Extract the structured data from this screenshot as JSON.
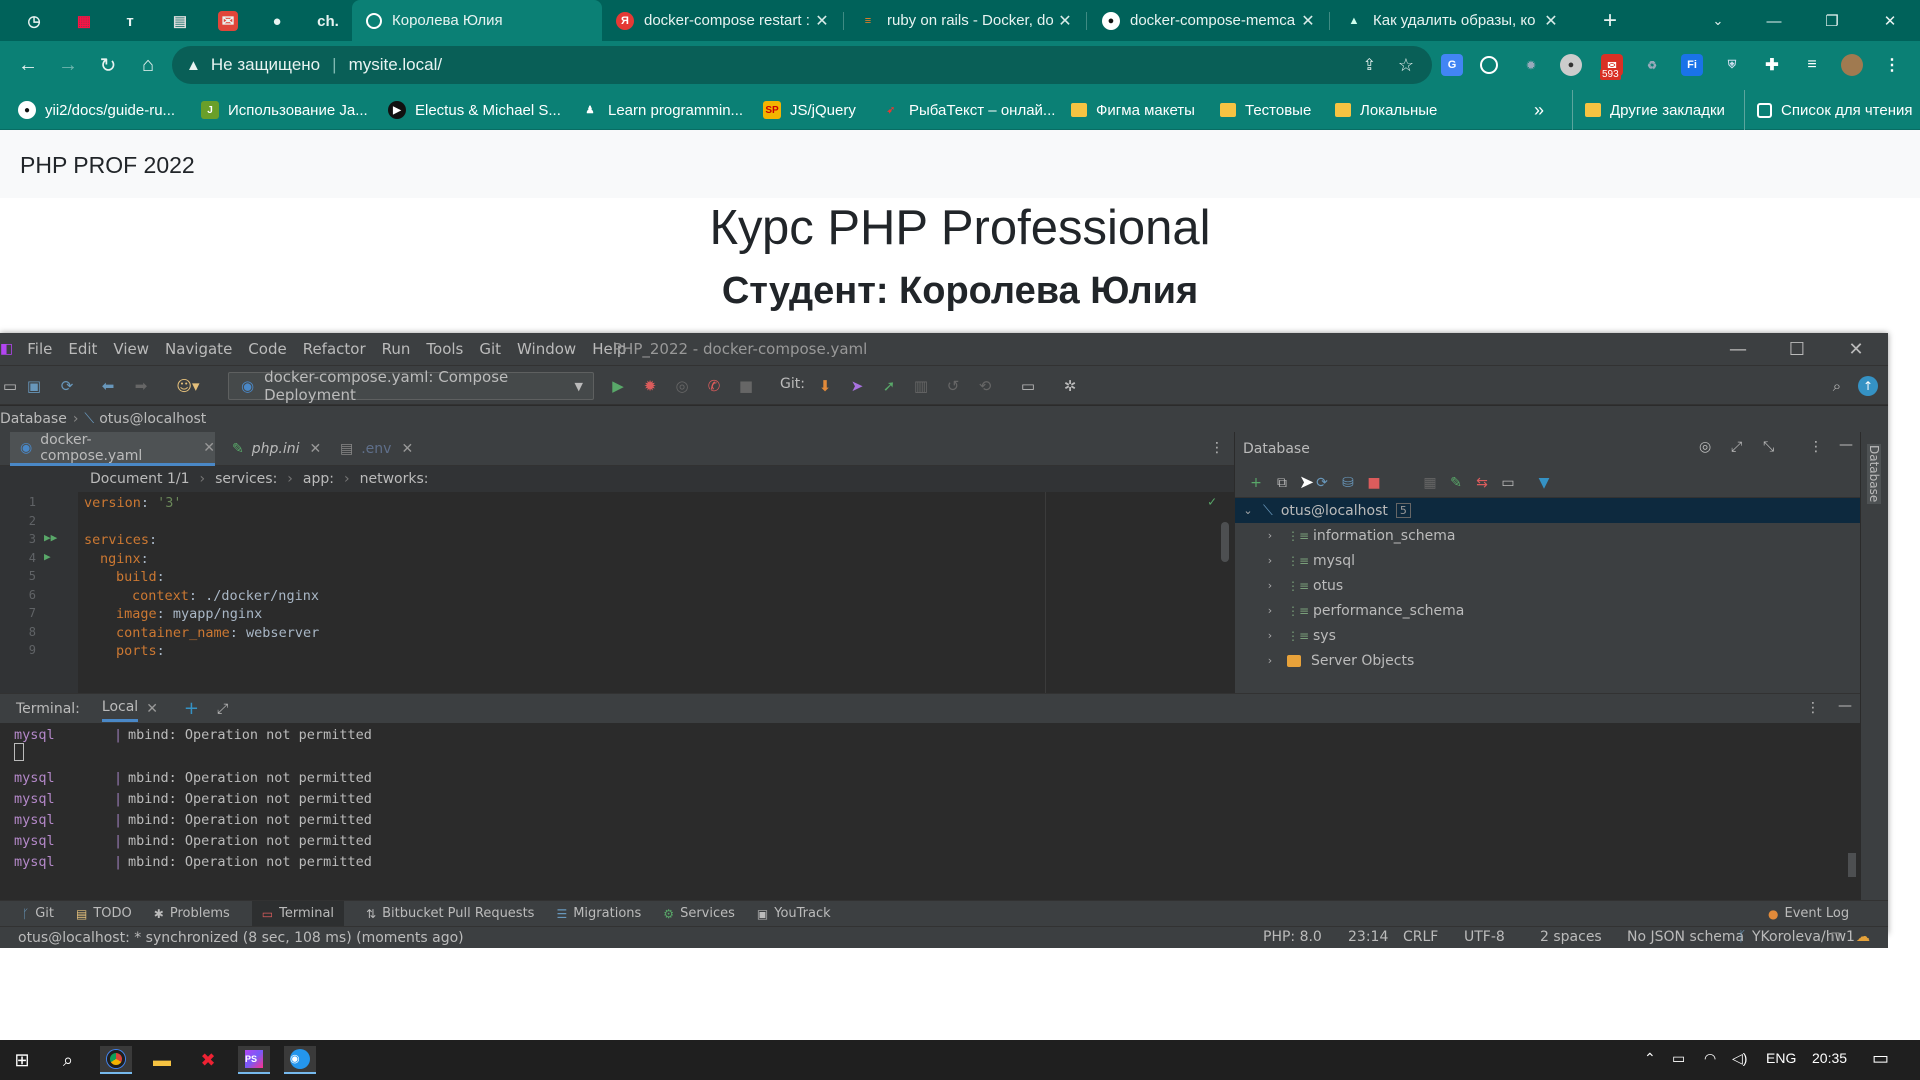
{
  "browser": {
    "pinned_tabs": [
      "ch."
    ],
    "tabs": [
      {
        "title": "Королева Юлия",
        "icon": "globe"
      },
      {
        "title": "docker-compose restart :",
        "icon": "yandex"
      },
      {
        "title": "ruby on rails - Docker, do",
        "icon": "stackoverflow"
      },
      {
        "title": "docker-compose-memca",
        "icon": "github"
      },
      {
        "title": "Как удалить образы, ко",
        "icon": "cap"
      }
    ],
    "new_tab": "+",
    "address": {
      "security": "Не защищено",
      "url": "mysite.local/"
    },
    "extension_badge": "593",
    "bookmarks": [
      "yii2/docs/guide-ru...",
      "Использование Ja...",
      "Electus & Michael S...",
      "Learn programmin...",
      "JS/jQuery",
      "РыбаТекст – онлай...",
      "Фигма макеты",
      "Тестовые",
      "Локальные"
    ],
    "bookmarks_more": "»",
    "other_bookmarks": "Другие закладки",
    "reading_list": "Список для чтения"
  },
  "page": {
    "brand": "PHP PROF 2022",
    "heading": "Курс PHP Professional",
    "subheading": "Студент: Королева Юлия"
  },
  "ide": {
    "menu": [
      "File",
      "Edit",
      "View",
      "Navigate",
      "Code",
      "Refactor",
      "Run",
      "Tools",
      "Git",
      "Window",
      "Help"
    ],
    "title": "PHP_2022 - docker-compose.yaml",
    "run_config": "docker-compose.yaml: Compose Deployment",
    "git_label": "Git:",
    "breadcrumb": [
      "Database",
      "otus@localhost"
    ],
    "editor_tabs": [
      "docker-compose.yaml",
      "php.ini",
      ".env"
    ],
    "editor_crumbs": [
      "Document 1/1",
      "services:",
      "app:",
      "networks:"
    ],
    "code": [
      {
        "n": "1",
        "parts": [
          [
            "k",
            "version"
          ],
          [
            "v",
            ": "
          ],
          [
            "s",
            "'3'"
          ]
        ],
        "indent": 0
      },
      {
        "n": "2",
        "parts": [],
        "indent": 0
      },
      {
        "n": "3",
        "parts": [
          [
            "k",
            "services"
          ],
          [
            "v",
            ":"
          ]
        ],
        "indent": 0
      },
      {
        "n": "4",
        "parts": [
          [
            "k",
            "nginx"
          ],
          [
            "v",
            ":"
          ]
        ],
        "indent": 1
      },
      {
        "n": "5",
        "parts": [
          [
            "k",
            "build"
          ],
          [
            "v",
            ":"
          ]
        ],
        "indent": 2
      },
      {
        "n": "6",
        "parts": [
          [
            "k",
            "context"
          ],
          [
            "v",
            ": ./docker/nginx"
          ]
        ],
        "indent": 3
      },
      {
        "n": "7",
        "parts": [
          [
            "k",
            "image"
          ],
          [
            "v",
            ": "
          ],
          [
            "v",
            "myapp/nginx"
          ]
        ],
        "indent": 2
      },
      {
        "n": "8",
        "parts": [
          [
            "k",
            "container_name"
          ],
          [
            "v",
            ": webserver"
          ]
        ],
        "indent": 2
      },
      {
        "n": "9",
        "parts": [
          [
            "k",
            "ports"
          ],
          [
            "v",
            ":"
          ]
        ],
        "indent": 2
      }
    ],
    "database": {
      "title": "Database",
      "root": {
        "name": "otus@localhost",
        "count": "5"
      },
      "schemas": [
        "information_schema",
        "mysql",
        "otus",
        "performance_schema",
        "sys"
      ],
      "server_objects": "Server Objects",
      "side_label": "Database"
    },
    "terminal": {
      "label": "Terminal:",
      "tab": "Local",
      "lines": [
        {
          "svc": "mysql",
          "msg": "mbind: Operation not permitted"
        },
        {
          "svc": "",
          "msg": ""
        },
        {
          "svc": "mysql",
          "msg": "mbind: Operation not permitted"
        },
        {
          "svc": "mysql",
          "msg": "mbind: Operation not permitted"
        },
        {
          "svc": "mysql",
          "msg": "mbind: Operation not permitted"
        },
        {
          "svc": "mysql",
          "msg": "mbind: Operation not permitted"
        },
        {
          "svc": "mysql",
          "msg": "mbind: Operation not permitted"
        }
      ]
    },
    "tool_windows": [
      "Git",
      "TODO",
      "Problems",
      "Terminal",
      "Bitbucket Pull Requests",
      "Migrations",
      "Services",
      "YouTrack"
    ],
    "event_log": "Event Log",
    "status": {
      "message": "otus@localhost: * synchronized (8 sec, 108 ms) (moments ago)",
      "php": "PHP: 8.0",
      "position": "23:14",
      "line_sep": "CRLF",
      "encoding": "UTF-8",
      "indent": "2 spaces",
      "schema": "No JSON schema",
      "branch": "YKoroleva/hw1"
    }
  },
  "taskbar": {
    "lang": "ENG",
    "time": "20:35"
  },
  "colors": {
    "chrome_frame": "#00625a",
    "chrome_toolbar": "#0b8075",
    "ide_bg": "#2b2b2b",
    "ide_panel": "#3c3f41",
    "accent": "#4a88c7"
  }
}
